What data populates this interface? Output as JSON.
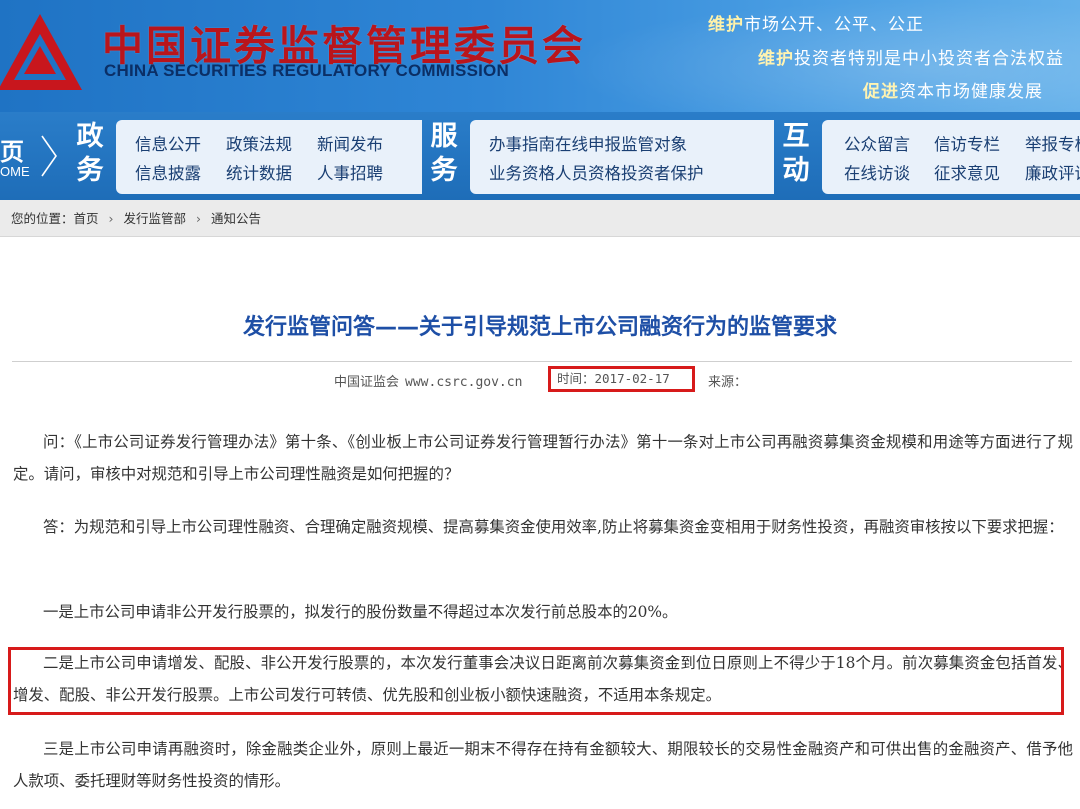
{
  "header": {
    "title_cn": "中国证券监督管理委员会",
    "title_en": "CHINA SECURITIES REGULATORY COMMISSION",
    "slogans": [
      {
        "lead": "维护",
        "rest": "市场公开、公平、公正"
      },
      {
        "lead": "维护",
        "rest": "投资者特别是中小投资者合法权益"
      },
      {
        "lead": "促进",
        "rest": "资本市场健康发展"
      }
    ],
    "colors": {
      "brand_red": "#b9151c",
      "banner_blue": "#2f86d6",
      "title_blue": "#1e4fa6",
      "highlight_red": "#d71a1a"
    }
  },
  "nav": {
    "home": {
      "cn": "页",
      "en": "OME"
    },
    "sections": [
      {
        "head": [
          "政",
          "务"
        ],
        "links": [
          "信息公开",
          "政策法规",
          "新闻发布",
          "信息披露",
          "统计数据",
          "人事招聘"
        ]
      },
      {
        "head": [
          "服",
          "务"
        ],
        "links": [
          "办事指南",
          "在线申报",
          "监管对象",
          "业务资格",
          "人员资格",
          "投资者保护"
        ]
      },
      {
        "head": [
          "互",
          "动"
        ],
        "links": [
          "公众留言",
          "信访专栏",
          "举报专栏",
          "在线访谈",
          "征求意见",
          "廉政评议"
        ]
      }
    ]
  },
  "breadcrumb": {
    "prefix": "您的位置：",
    "items": [
      "首页",
      "发行监管部",
      "通知公告"
    ],
    "separator": "›"
  },
  "article": {
    "title": "发行监管问答——关于引导规范上市公司融资行为的监管要求",
    "source_label": "中国证监会",
    "source_site": "www.csrc.gov.cn",
    "time": "时间：2017-02-17",
    "origin_label": "来源：",
    "paragraphs": [
      "问：《上市公司证券发行管理办法》第十条、《创业板上市公司证券发行管理暂行办法》第十一条对上市公司再融资募集资金规模和用途等方面进行了规定。请问，审核中对规范和引导上市公司理性融资是如何把握的？",
      "答：为规范和引导上市公司理性融资、合理确定融资规模、提高募集资金使用效率,防止将募集资金变相用于财务性投资，再融资审核按以下要求把握：",
      "一是上市公司申请非公开发行股票的，拟发行的股份数量不得超过本次发行前总股本的20%。",
      "二是上市公司申请增发、配股、非公开发行股票的，本次发行董事会决议日距离前次募集资金到位日原则上不得少于18个月。前次募集资金包括首发、增发、配股、非公开发行股票。上市公司发行可转债、优先股和创业板小额快速融资，不适用本条规定。",
      "三是上市公司申请再融资时，除金融类企业外，原则上最近一期末不得存在持有金额较大、期限较长的交易性金融资产和可供出售的金融资产、借予他人款项、委托理财等财务性投资的情形。"
    ]
  }
}
